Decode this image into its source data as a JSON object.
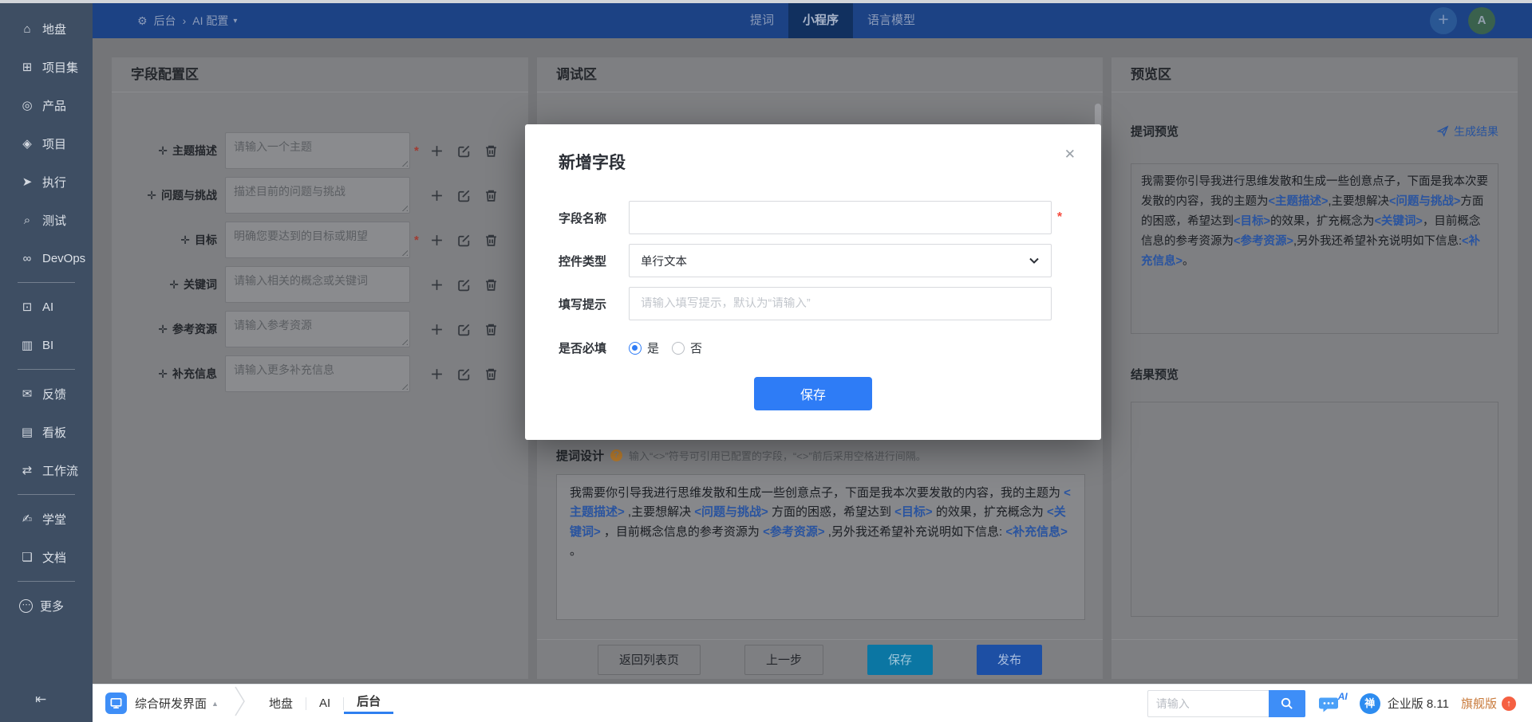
{
  "sidebar": {
    "items": [
      {
        "id": "home",
        "icon": "⌂",
        "label": "地盘"
      },
      {
        "id": "program",
        "icon": "⊞",
        "label": "项目集"
      },
      {
        "id": "product",
        "icon": "◎",
        "label": "产品"
      },
      {
        "id": "project",
        "icon": "◈",
        "label": "项目"
      },
      {
        "id": "execution",
        "icon": "➤",
        "label": "执行"
      },
      {
        "id": "qa",
        "icon": "⌕",
        "label": "测试"
      },
      {
        "id": "devops",
        "icon": "∞",
        "label": "DevOps",
        "divider_after": true
      },
      {
        "id": "ai",
        "icon": "⊡",
        "label": "AI"
      },
      {
        "id": "bi",
        "icon": "▥",
        "label": "BI",
        "divider_after": true
      },
      {
        "id": "feedback",
        "icon": "✉",
        "label": "反馈"
      },
      {
        "id": "kanban",
        "icon": "▤",
        "label": "看板"
      },
      {
        "id": "workflow",
        "icon": "⇄",
        "label": "工作流",
        "divider_after": true
      },
      {
        "id": "learn",
        "icon": "✍",
        "label": "学堂"
      },
      {
        "id": "doc",
        "icon": "❏",
        "label": "文档",
        "divider_after": true
      },
      {
        "id": "more",
        "icon": "⋯",
        "label": "更多",
        "circle_icon": true
      }
    ],
    "collapse_icon": "⇤"
  },
  "header": {
    "gear_icon": "⚙",
    "breadcrumb": {
      "root": "后台",
      "separator": "›",
      "current": "AI 配置",
      "caret": "▾"
    },
    "tabs": [
      {
        "label": "提词",
        "active": false
      },
      {
        "label": "小程序",
        "active": true
      },
      {
        "label": "语言模型",
        "active": false
      }
    ],
    "plus": "+",
    "avatar": "A"
  },
  "config_panel": {
    "title": "字段配置区",
    "move_icon": "✛",
    "required_mark": "*",
    "rows": [
      {
        "label": "主题描述",
        "placeholder": "请输入一个主题",
        "required": true,
        "resize": true
      },
      {
        "label": "问题与挑战",
        "placeholder": "描述目前的问题与挑战",
        "required": false,
        "resize": true
      },
      {
        "label": "目标",
        "placeholder": "明确您要达到的目标或期望",
        "required": true,
        "resize": true
      },
      {
        "label": "关键词",
        "placeholder": "请输入相关的概念或关键词",
        "required": false,
        "resize": false
      },
      {
        "label": "参考资源",
        "placeholder": "请输入参考资源",
        "required": false,
        "resize": true
      },
      {
        "label": "补充信息",
        "placeholder": "请输入更多补充信息",
        "required": false,
        "resize": true
      }
    ]
  },
  "debug_panel": {
    "title": "调试区",
    "design": {
      "title": "提词设计",
      "help_mark": "?",
      "hint": "输入“<>”符号可引用已配置的字段，“<>”前后采用空格进行间隔。",
      "segments": [
        {
          "t": "我需要你引导我进行思维发散和生成一些创意点子，下面是我本次要发散的内容，我的主题为 "
        },
        {
          "t": "<主题描述>",
          "f": true
        },
        {
          "t": " ,主要想解决 "
        },
        {
          "t": "<问题与挑战>",
          "f": true
        },
        {
          "t": " 方面的困惑，希望达到 "
        },
        {
          "t": "<目标>",
          "f": true
        },
        {
          "t": " 的效果，扩充概念为 "
        },
        {
          "t": "<关键词>",
          "f": true
        },
        {
          "t": " ，目前概念信息的参考资源为 "
        },
        {
          "t": "<参考资源>",
          "f": true
        },
        {
          "t": " ,另外我还希望补充说明如下信息: "
        },
        {
          "t": "<补充信息>",
          "f": true
        },
        {
          "t": " 。"
        }
      ]
    },
    "actions": [
      {
        "label": "返回列表页",
        "style": "ghost"
      },
      {
        "label": "上一步",
        "style": "ghost"
      },
      {
        "label": "保存",
        "style": "save"
      },
      {
        "label": "发布",
        "style": "publish"
      }
    ]
  },
  "preview_panel": {
    "title": "预览区",
    "prompt": {
      "title": "提词预览",
      "generate_label": "生成结果",
      "segments": [
        {
          "t": "我需要你引导我进行思维发散和生成一些创意点子，下面是我本次要发散的内容，我的主题为"
        },
        {
          "t": "<主题描述>",
          "f": true
        },
        {
          "t": ",主要想解决"
        },
        {
          "t": "<问题与挑战>",
          "f": true
        },
        {
          "t": "方面的困惑，希望达到"
        },
        {
          "t": "<目标>",
          "f": true
        },
        {
          "t": "的效果，扩充概念为"
        },
        {
          "t": "<关键词>",
          "f": true
        },
        {
          "t": "，目前概念信息的参考资源为"
        },
        {
          "t": "<参考资源>",
          "f": true
        },
        {
          "t": ",另外我还希望补充说明如下信息:"
        },
        {
          "t": "<补充信息>",
          "f": true
        },
        {
          "t": "。"
        }
      ]
    },
    "result": {
      "title": "结果预览"
    }
  },
  "modal": {
    "title": "新增字段",
    "close": "✕",
    "save_label": "保存",
    "fields": {
      "name": {
        "label": "字段名称",
        "required_mark": "*"
      },
      "type": {
        "label": "控件类型",
        "value": "单行文本"
      },
      "hint": {
        "label": "填写提示",
        "placeholder": "请输入填写提示，默认为“请输入”"
      },
      "required": {
        "label": "是否必填",
        "options": [
          {
            "label": "是",
            "checked": true
          },
          {
            "label": "否",
            "checked": false
          }
        ]
      }
    }
  },
  "taskbar": {
    "app": {
      "label": "综合研发界面",
      "caret": "▲"
    },
    "nav": [
      {
        "label": "地盘",
        "active": false
      },
      {
        "label": "AI",
        "active": false
      },
      {
        "label": "后台",
        "active": true
      }
    ],
    "search": {
      "placeholder": "请输入"
    },
    "ai_badge": "AI",
    "edition": "企业版 8.11",
    "upgrade": {
      "label": "旗舰版",
      "badge": "↑"
    }
  },
  "colors": {
    "primary": "#2e7cf6",
    "taskbar_blue": "#3e8ef7",
    "upgrade_orange": "#c8793a",
    "badge_red": "#f56042",
    "required_red": "#f5483b"
  }
}
